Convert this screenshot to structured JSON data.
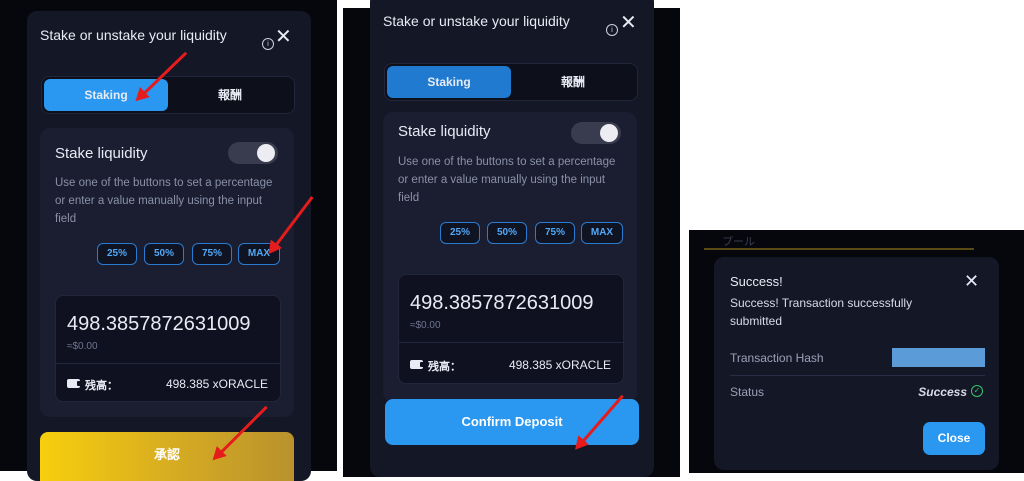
{
  "colors": {
    "accent": "#2a97f0",
    "approve_gradient": [
      "#f7cf0d",
      "#b8922d"
    ],
    "annotation_arrow": "#e61c1c",
    "success_green": "#35c76a"
  },
  "panel1": {
    "title": "Stake or unstake your liquidity",
    "tabs": [
      "Staking",
      "報酬"
    ],
    "stake_label": "Stake liquidity",
    "description": "Use one of the buttons to set a percentage or enter a value manually using the input field",
    "percent_buttons": [
      "25%",
      "50%",
      "75%",
      "MAX"
    ],
    "amount": "498.3857872631009",
    "fiat": "≈$0.00",
    "balance_label": "残高：",
    "balance_value": "498.385 xORACLE",
    "action_button": "承認"
  },
  "panel2": {
    "title": "Stake or unstake your liquidity",
    "tabs": [
      "Staking",
      "報酬"
    ],
    "stake_label": "Stake liquidity",
    "description": "Use one of the buttons to set a percentage or enter a value manually using the input field",
    "percent_buttons": [
      "25%",
      "50%",
      "75%",
      "MAX"
    ],
    "amount": "498.3857872631009",
    "fiat": "≈$0.00",
    "balance_label": "残高：",
    "balance_value": "498.385 xORACLE",
    "action_button": "Confirm Deposit"
  },
  "panel3": {
    "background_text": "プール",
    "title": "Success!",
    "message": "Success! Transaction successfully submitted",
    "hash_label": "Transaction Hash",
    "status_label": "Status",
    "status_value": "Success",
    "close_button": "Close"
  },
  "icons": {
    "info": "i",
    "close": "✕",
    "check": "✓",
    "wallet": "wallet-icon"
  }
}
